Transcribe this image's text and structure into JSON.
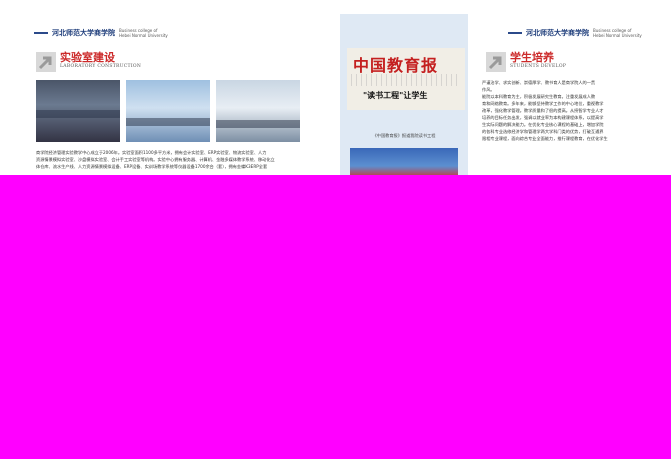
{
  "header": {
    "school": "河北师范大学商学院",
    "english_line1": "Business college of",
    "english_line2": "Hebei Normal University"
  },
  "lab": {
    "title": "实验室建设",
    "subtitle": "LABORATORY CONSTRUCTION",
    "paragraph_line1": "商学院经济管理实验教学中心成立于2006年。实验室面积1100多平方米，拥有会计实验室、ERP实验室、物流实验室、人力",
    "paragraph_line2": "资源情景模拟实验室、沙盘模拟实验室、会计手工实验室等机构。实验中心拥有服务器、计算机、金融多媒体教学系统、移动化立",
    "paragraph_line3": "体仓库、流水生产线、人力资源情景模拟设备、ERP设备、实训场教学系统等仪器设备1700余台（套），拥有金蝶K3ERP全套"
  },
  "students": {
    "title": "学生培养",
    "subtitle": "STUDENTS DEVELOP",
    "paragraph_lines": [
      "严谨治学、求实创新、崇德厚学、教书育人是商学院人的一贯",
      "作风。",
      "     能院以本科教育为主，积极发展研究生教育。注重发展成人教",
      "育和网络教育。多年来，能够坚持教学工作的中心地位，重视教学",
      "改革，强化教学管理。教学质量和了很的提高。从授智学专业人才",
      "培养的目标任务出发，强调以就业率为本构建课程体系，以提高学",
      "生实际问题的解决能力。在优化专业核心课程的基础上，增加学院",
      "的各科专业选修经济学和管理学两大学科门类的优势，打破互通界",
      "限相专业课程，面向综合专业全面能力，推行课程教育，在优化学生"
    ]
  },
  "newspaper": {
    "masthead": "中国教育报",
    "headline": "\"读书工程\"让学生",
    "caption": "《中国教育报》报道我院读书工程"
  },
  "colors": {
    "accent_red": "#cc2a2a",
    "navy": "#1d3c7a",
    "panel_blue": "#dfe9f4",
    "corruption_magenta": "#ff00ff"
  }
}
